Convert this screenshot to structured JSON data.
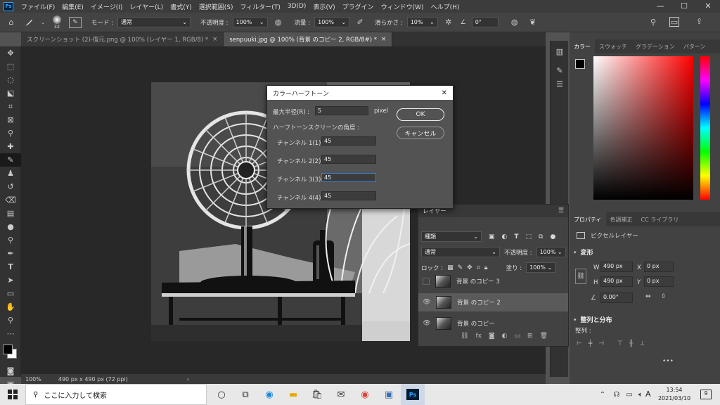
{
  "app": {
    "logo": "Ps"
  },
  "menu": [
    "ファイル(F)",
    "編集(E)",
    "イメージ(I)",
    "レイヤー(L)",
    "書式(Y)",
    "選択範囲(S)",
    "フィルター(T)",
    "3D(D)",
    "表示(V)",
    "プラグイン",
    "ウィンドウ(W)",
    "ヘルプ(H)"
  ],
  "window_controls": {
    "minimize": "—",
    "maximize": "☐",
    "close": "✕"
  },
  "options_bar": {
    "brush_size": "32",
    "mode_label": "モード :",
    "mode_value": "通常",
    "opacity_label": "不透明度 :",
    "opacity_value": "100%",
    "flow_label": "流量 :",
    "flow_value": "100%",
    "smoothing_label": "滑らかさ :",
    "smoothing_value": "10%",
    "angle_value": "0°"
  },
  "tabs": [
    {
      "label": "スクリーンショット (2)-復元.png @ 100% (レイヤー 1, RGB/8) *",
      "close": "×"
    },
    {
      "label": "senpuuki.jpg @ 100% (背景 のコピー 2, RGB/8#) *",
      "close": "×"
    }
  ],
  "statusbar": {
    "zoom": "100%",
    "doc_info": "490 px x 490 px (72 ppi)",
    "arrow": "›"
  },
  "color_panel": {
    "tabs": [
      "カラー",
      "スウォッチ",
      "グラデーション",
      "パターン"
    ]
  },
  "props_panel": {
    "tabs": [
      "プロパティ",
      "色調補正",
      "CC ライブラリ"
    ],
    "layer_type": "ピクセルレイヤー",
    "transform_title": "変形",
    "w_label": "W",
    "w_value": "490 px",
    "x_label": "X",
    "x_value": "0 px",
    "h_label": "H",
    "h_value": "490 px",
    "y_label": "Y",
    "y_value": "0 px",
    "angle_value": "0.00°",
    "align_title": "整列と分布",
    "align_label": "整列 :",
    "more": "•••"
  },
  "layers_panel": {
    "tab": "レイヤー",
    "filter_value": "種類",
    "blend_value": "通常",
    "opacity_label": "不透明度 :",
    "opacity_value": "100%",
    "lock_label": "ロック :",
    "fill_label": "塗り :",
    "fill_value": "100%",
    "layers": [
      {
        "name": "背景 のコピー 3",
        "visible": false
      },
      {
        "name": "背景 のコピー 2",
        "visible": true
      },
      {
        "name": "背景 のコピー",
        "visible": true
      }
    ]
  },
  "dialog": {
    "title": "カラーハーフトーン",
    "max_radius_label": "最大半径(R) :",
    "max_radius_value": "5",
    "unit": "pixel",
    "angles_title": "ハーフトーンスクリーンの角度 :",
    "channels": [
      {
        "label": "チャンネル 1(1) :",
        "value": "45"
      },
      {
        "label": "チャンネル 2(2) :",
        "value": "45"
      },
      {
        "label": "チャンネル 3(3) :",
        "value": "45"
      },
      {
        "label": "チャンネル 4(4) :",
        "value": "45"
      }
    ],
    "ok": "OK",
    "cancel": "キャンセル",
    "close": "✕"
  },
  "taskbar": {
    "search_placeholder": "ここに入力して検索",
    "time": "13:54",
    "date": "2021/03/10",
    "ime": "A",
    "notif_count": "9"
  }
}
